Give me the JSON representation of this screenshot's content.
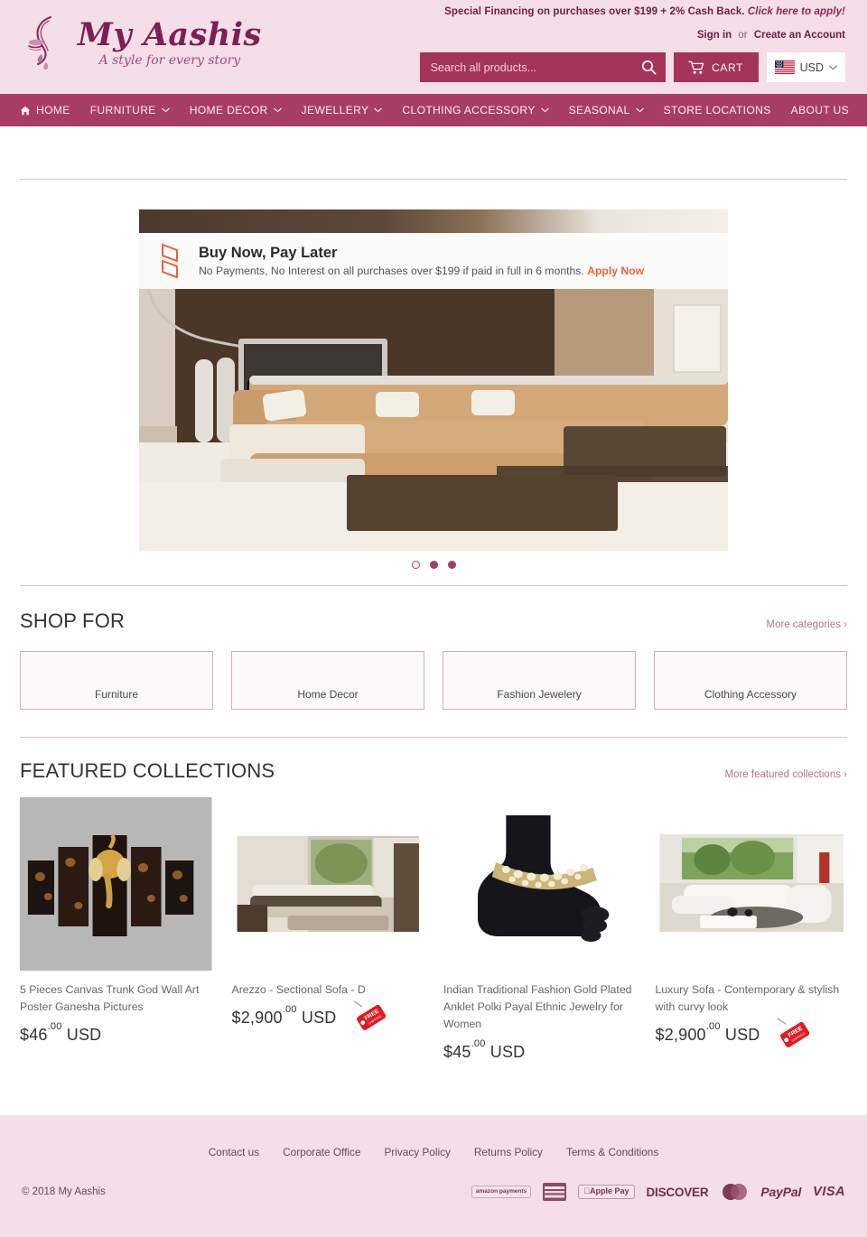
{
  "header": {
    "logo_name": "My Aashis",
    "logo_tagline": "A style for every story",
    "logo_icon": "woman-face-profile-logo",
    "promo_text": "Special Financing on purchases over $199 + 2% Cash Back.",
    "promo_link": "Click here to apply!",
    "sign_in": "Sign in",
    "or": "or",
    "create_account": "Create an Account",
    "search_placeholder": "Search all products...",
    "search_value": "",
    "cart_label": "CART",
    "currency": "USD",
    "currency_flag": "us-flag-icon"
  },
  "nav": {
    "items": [
      {
        "label": "HOME",
        "icon": "home-icon",
        "caret": false
      },
      {
        "label": "FURNITURE",
        "icon": "",
        "caret": true
      },
      {
        "label": "HOME DECOR",
        "icon": "",
        "caret": true
      },
      {
        "label": "JEWELLERY",
        "icon": "",
        "caret": true
      },
      {
        "label": "CLOTHING ACCESSORY",
        "icon": "",
        "caret": true
      },
      {
        "label": "SEASONAL",
        "icon": "",
        "caret": true
      },
      {
        "label": "STORE LOCATIONS",
        "icon": "",
        "caret": false
      },
      {
        "label": "ABOUT US",
        "icon": "",
        "caret": false
      }
    ]
  },
  "hero": {
    "promo_title": "Buy Now, Pay Later",
    "promo_sub": "No Payments, No Interest on all purchases over $199 if paid in full in 6 months.",
    "promo_cta": "Apply Now",
    "slide_count": 3,
    "active_slide": 1
  },
  "shop_for": {
    "title": "SHOP FOR",
    "more": "More categories ›",
    "categories": [
      {
        "label": "Furniture"
      },
      {
        "label": "Home Decor"
      },
      {
        "label": "Fashion Jewelery"
      },
      {
        "label": "Clothing Accessory"
      }
    ]
  },
  "featured": {
    "title": "FEATURED COLLECTIONS",
    "more": "More featured collections ›",
    "products": [
      {
        "title": "5 Pieces Canvas Trunk God Wall Art Poster Ganesha Pictures",
        "price_main": "$46",
        "price_cents": ".00",
        "currency": "USD",
        "free_shipping": false,
        "image": "ganesha-canvas-art"
      },
      {
        "title": "Arezzo - Sectional Sofa - D",
        "price_main": "$2,900",
        "price_cents": ".00",
        "currency": "USD",
        "free_shipping": true,
        "image": "arezzo-sectional-sofa"
      },
      {
        "title": "Indian Traditional Fashion Gold Plated Anklet Polki Payal Ethnic Jewelry for Women",
        "price_main": "$45",
        "price_cents": ".00",
        "currency": "USD",
        "free_shipping": false,
        "image": "gold-anklet-on-foot"
      },
      {
        "title": "Luxury Sofa - Contemporary & stylish with curvy look",
        "price_main": "$2,900",
        "price_cents": ".00",
        "currency": "USD",
        "free_shipping": true,
        "image": "luxury-white-sofa"
      }
    ]
  },
  "footer": {
    "links": [
      "Contact us",
      "Corporate Office",
      "Privacy Policy",
      "Returns Policy",
      "Terms & Conditions"
    ],
    "copyright": "© 2018 My Aashis",
    "payments": [
      "amazon payments",
      "american express",
      "Apple Pay",
      "DISCOVER",
      "mastercard",
      "PayPal",
      "VISA"
    ]
  },
  "colors": {
    "brand_pink": "#f4dee7",
    "brand_maroon": "#a83d63",
    "brand_dark": "#7d1f55",
    "accent_orange": "#e8633a"
  }
}
